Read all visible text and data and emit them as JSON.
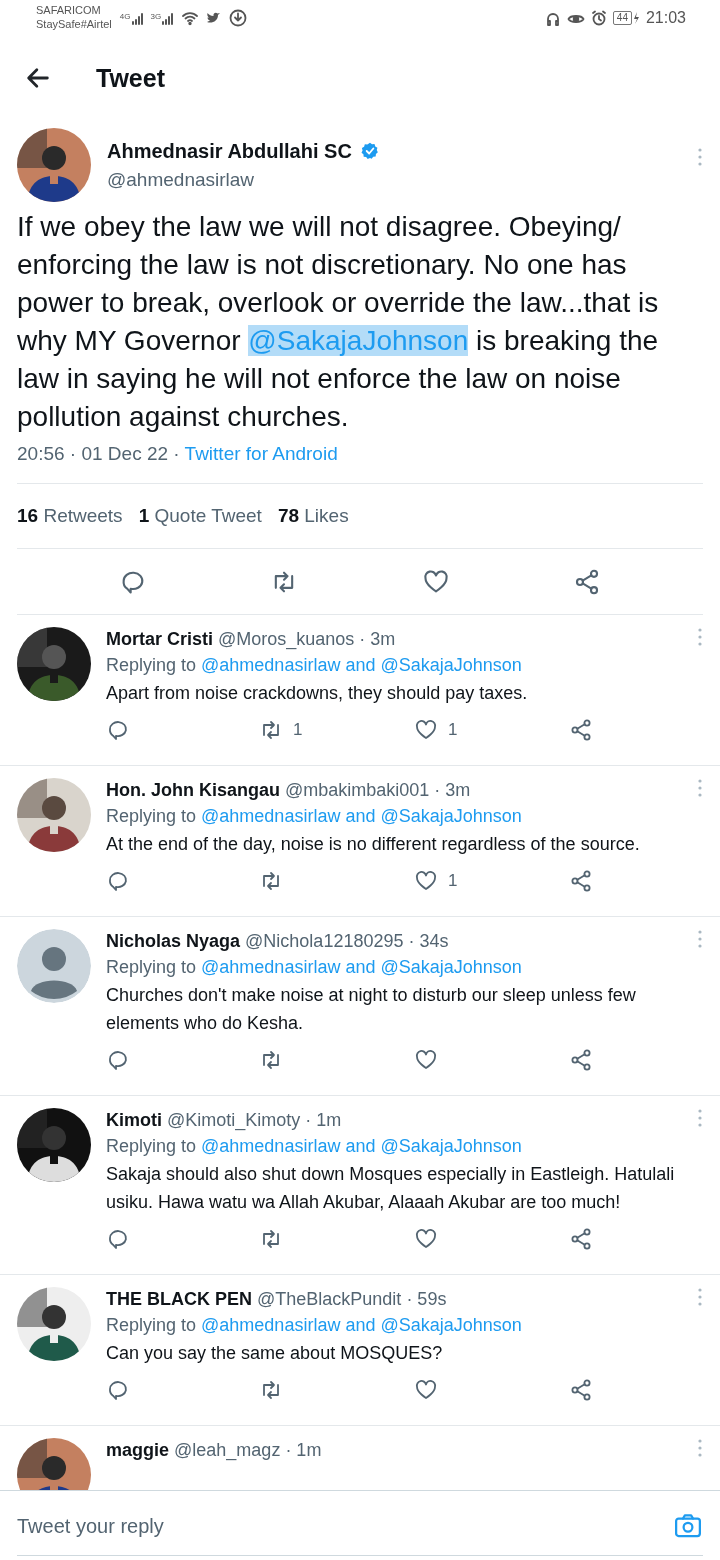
{
  "status_bar": {
    "carrier": "SAFARICOM",
    "carrier_2": "StaySafe#Airtel",
    "network_1": "4G",
    "network_2": "3G",
    "battery": "44",
    "time": "21:03"
  },
  "header": {
    "title": "Tweet"
  },
  "tweet": {
    "name": "Ahmednasir Abdullahi SC",
    "verified": true,
    "handle": "@ahmednasirlaw",
    "text_before": "If we obey the law we will not disagree. Obeying/ enforcing the law is not discretionary. No one has power to break, overlook or override the law...that is why MY Governor ",
    "mention": {
      "text": "@SakajaJohnson",
      "selected": true
    },
    "text_after": " is breaking the law in saying he will not enforce the law on noise pollution against churches.",
    "timestamp": "20:56 · 01 Dec 22 · ",
    "source": "Twitter for Android",
    "stats": [
      {
        "count": "16",
        "label": "Retweets"
      },
      {
        "count": "1",
        "label": "Quote Tweet"
      },
      {
        "count": "78",
        "label": "Likes"
      }
    ]
  },
  "replies": [
    {
      "name": "Mortar Cristi",
      "handle": "@Moros_kuanos · 3m",
      "replying_label": "Replying to ",
      "replying_to": "@ahmednasirlaw and @SakajaJohnson",
      "text": "Apart from noise crackdowns, they should pay taxes.",
      "retweets": "1",
      "likes": "1"
    },
    {
      "name": "Hon. John Kisangau",
      "handle": "@mbakimbaki001 · 3m",
      "replying_label": "Replying to ",
      "replying_to": "@ahmednasirlaw and @SakajaJohnson",
      "text": "At the end of the day, noise is no different regardless of the source.",
      "likes": "1"
    },
    {
      "avatar": {
        "kind": "default"
      },
      "name": "Nicholas Nyaga",
      "handle": "@Nichola12180295 · 34s",
      "replying_label": "Replying to ",
      "replying_to": "@ahmednasirlaw and @SakajaJohnson",
      "text": "Churches don't make noise at night to disturb our sleep unless few elements who do Kesha."
    },
    {
      "name": "Kimoti",
      "handle": "@Kimoti_Kimoty · 1m",
      "replying_label": "Replying to ",
      "replying_to": "@ahmednasirlaw and @SakajaJohnson",
      "text": "Sakaja should also shut down Mosques especially in Eastleigh. Hatulali usiku. Hawa watu wa Allah Akubar, Alaaah Akubar are too much!"
    },
    {
      "name": "THE BLACK PEN",
      "handle": "@TheBlackPundit · 59s",
      "replying_label": "Replying to ",
      "replying_to": "@ahmednasirlaw and @SakajaJohnson",
      "text": "Can you say the same about MOSQUES?"
    },
    {
      "name": "maggie",
      "handle": "@leah_magz · 1m"
    }
  ],
  "reply_bar": {
    "placeholder": "Tweet your reply"
  }
}
